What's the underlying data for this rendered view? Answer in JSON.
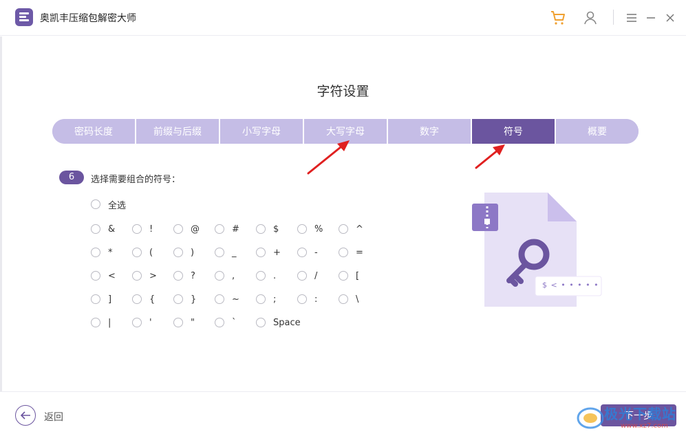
{
  "app": {
    "title": "奥凯丰压缩包解密大师"
  },
  "page": {
    "title": "字符设置"
  },
  "steps": [
    {
      "label": "密码长度",
      "active": false
    },
    {
      "label": "前缀与后缀",
      "active": false
    },
    {
      "label": "小写字母",
      "active": false
    },
    {
      "label": "大写字母",
      "active": false
    },
    {
      "label": "数字",
      "active": false
    },
    {
      "label": "符号",
      "active": true
    },
    {
      "label": "概要",
      "active": false
    }
  ],
  "question": {
    "number": "6",
    "text": "选择需要组合的符号："
  },
  "select_all": "全选",
  "symbols": [
    [
      "&",
      "!",
      "@",
      "#",
      "$",
      "%",
      "^"
    ],
    [
      "*",
      "(",
      ")",
      "_",
      "+",
      "-",
      "="
    ],
    [
      "<",
      ">",
      "?",
      ",",
      ".",
      "/",
      "["
    ],
    [
      "]",
      "{",
      "}",
      "~",
      ";",
      ":",
      "\\"
    ],
    [
      "|",
      "'",
      "\"",
      "`",
      "Space"
    ]
  ],
  "illustration": {
    "password_hint": "$ < • • • • •"
  },
  "footer": {
    "back_label": "返回",
    "next_label": "下一步"
  },
  "watermark": {
    "text": "极光下载站",
    "url": "www.xz7.com"
  },
  "colors": {
    "accent": "#6b559f",
    "step_inactive": "#c5bde6",
    "cart": "#f0a030",
    "arrow": "#e02020"
  }
}
